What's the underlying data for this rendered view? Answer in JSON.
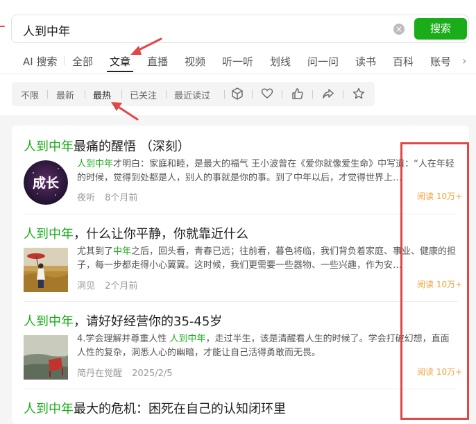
{
  "search": {
    "query": "人到中年",
    "clear_icon": "close-circle-icon",
    "button_label": "搜索"
  },
  "tabs": [
    {
      "label": "AI 搜索"
    },
    {
      "label": "全部"
    },
    {
      "label": "文章",
      "active": true
    },
    {
      "label": "直播"
    },
    {
      "label": "视频"
    },
    {
      "label": "听一听"
    },
    {
      "label": "划线"
    },
    {
      "label": "问一问"
    },
    {
      "label": "读书"
    },
    {
      "label": "百科"
    },
    {
      "label": "账号"
    }
  ],
  "tabs_more_icon": "chevron-right-icon",
  "filters": [
    {
      "label": "不限"
    },
    {
      "label": "最新"
    },
    {
      "label": "最热",
      "active": true
    },
    {
      "label": "已关注"
    },
    {
      "label": "最近读过"
    }
  ],
  "filter_icons": [
    "cube-icon",
    "heart-icon",
    "thumbs-up-icon",
    "share-icon",
    "star-icon"
  ],
  "results": [
    {
      "title_highlight": "人到中年",
      "title_rest": "最痛的醒悟 （深刻）",
      "thumb_text": "成长",
      "snippet_highlight": "人到中年",
      "snippet_rest": "才明白：家庭和睦，是最大的福气 王小波曾在《爱你就像爱生命》中写道：“人在年轻的时候，觉得到处都是人，别人的事就是你的事。到了中年以后，才觉得世界上…",
      "author": "夜听",
      "time": "8个月前",
      "reads": "阅读 10万+"
    },
    {
      "title_highlight": "人到中年",
      "title_rest": "，什么让你平静，你就靠近什么",
      "snippet_pre": "尤其到了",
      "snippet_highlight": "中年",
      "snippet_rest": "之后，回头看，青春已远；往前看，暮色将临，我们背负着家庭、事业、健康的担子，每一步都走得小心翼翼。这时候，我们更需要一些器物、一些兴趣，作为安…",
      "author": "洞见",
      "time": "2个月前",
      "reads": "阅读 10万+"
    },
    {
      "title_highlight": "人到中年",
      "title_rest": "，请好好经营你的35-45岁",
      "snippet_pre": "4.学会理解并尊重人性 ",
      "snippet_highlight": "人到中年",
      "snippet_rest": "，走过半生，该是清醒看人生的时候了。学会打破幻想，直面人性的复杂，洞悉人心的幽暗，才能让自己活得勇敢而无畏。",
      "author": "简丹在觉醒",
      "time": "2025/2/5",
      "reads": "阅读 10万+"
    },
    {
      "title_highlight": "人到中年",
      "title_rest": "最大的危机：困死在自己的认知闭环里"
    }
  ],
  "colors": {
    "accent_green": "#1aad19",
    "reads_orange": "#f0a23b",
    "annotation_red": "#e04848"
  }
}
